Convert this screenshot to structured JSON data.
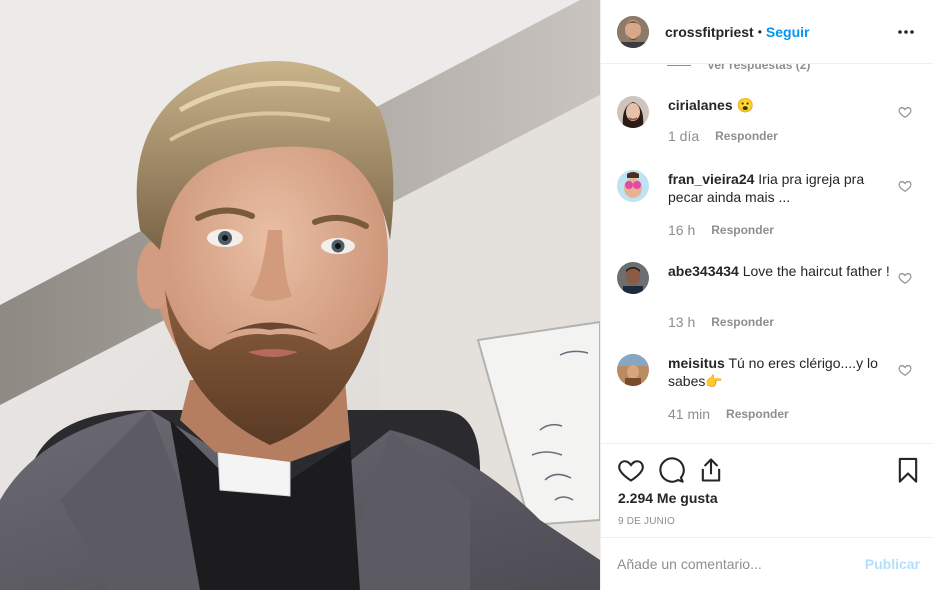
{
  "post": {
    "username": "crossfitpriest",
    "separator": "•",
    "follow_label": "Seguir",
    "more_label": "more-options",
    "photo_alt": "Selfie of a bearded man wearing a clerical collar"
  },
  "thread": {
    "view_replies_label": "Ver respuestas (2)"
  },
  "comments": [
    {
      "user": "cirialanes",
      "text": "😮",
      "age": "1 día",
      "reply_label": "Responder"
    },
    {
      "user": "fran_vieira24",
      "text": "Iria pra igreja pra pecar ainda mais ...",
      "age": "16 h",
      "reply_label": "Responder"
    },
    {
      "user": "abe343434",
      "text": "Love the haircut father !",
      "age": "13 h",
      "reply_label": "Responder"
    },
    {
      "user": "meisitus",
      "text": "Tú no eres clérigo....y lo sabes👉",
      "age": "41 min",
      "reply_label": "Responder"
    }
  ],
  "stats": {
    "likes": "2.294 Me gusta",
    "date": "9 DE JUNIO"
  },
  "composer": {
    "placeholder": "Añade un comentario...",
    "post_label": "Publicar"
  },
  "icons": {
    "like": "heart-icon",
    "comment": "comment-icon",
    "share": "share-icon",
    "save": "bookmark-icon",
    "comment_like": "heart-icon"
  },
  "colors": {
    "accent": "#0095f6",
    "muted": "#8e8e8e",
    "text": "#262626",
    "post_disabled": "#b2dffc",
    "border": "#efefef"
  }
}
